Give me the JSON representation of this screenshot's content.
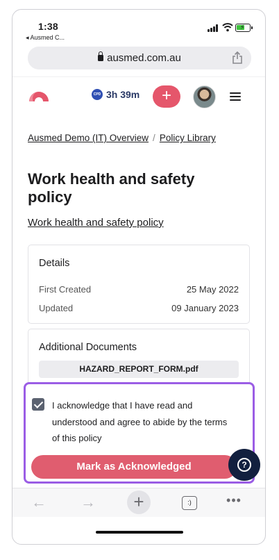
{
  "status_bar": {
    "time": "1:38",
    "back_app": "◂ Ausmed C..."
  },
  "browser": {
    "url": "ausmed.com.au",
    "toolbar": {
      "back_icon": "←",
      "forward_icon": "→",
      "new_tab_icon": "+",
      "tabs_icon": ":)",
      "more_icon": "•••"
    }
  },
  "site_header": {
    "cpd_badge": "CPD",
    "cpd_time": "3h 39m",
    "add_icon": "+"
  },
  "breadcrumb": {
    "items": [
      "Ausmed Demo (IT) Overview",
      "Policy Library"
    ],
    "separator": "/"
  },
  "page": {
    "title": "Work health and safety policy",
    "document_link": "Work health and safety policy"
  },
  "details": {
    "heading": "Details",
    "rows": [
      {
        "label": "First Created",
        "value": "25 May 2022"
      },
      {
        "label": "Updated",
        "value": "09 January 2023"
      }
    ]
  },
  "additional_documents": {
    "heading": "Additional Documents",
    "files": [
      "HAZARD_REPORT_FORM.pdf"
    ]
  },
  "acknowledge": {
    "checked": true,
    "text": "I acknowledge that I have read and understood and agree to abide by the terms of this policy",
    "button_label": "Mark as Acknowledged",
    "help_icon": "?"
  },
  "colors": {
    "accent": "#e5566b",
    "highlight_border": "#9b5de5",
    "help_button": "#12203f",
    "cpd_badge": "#2f4fb3"
  }
}
